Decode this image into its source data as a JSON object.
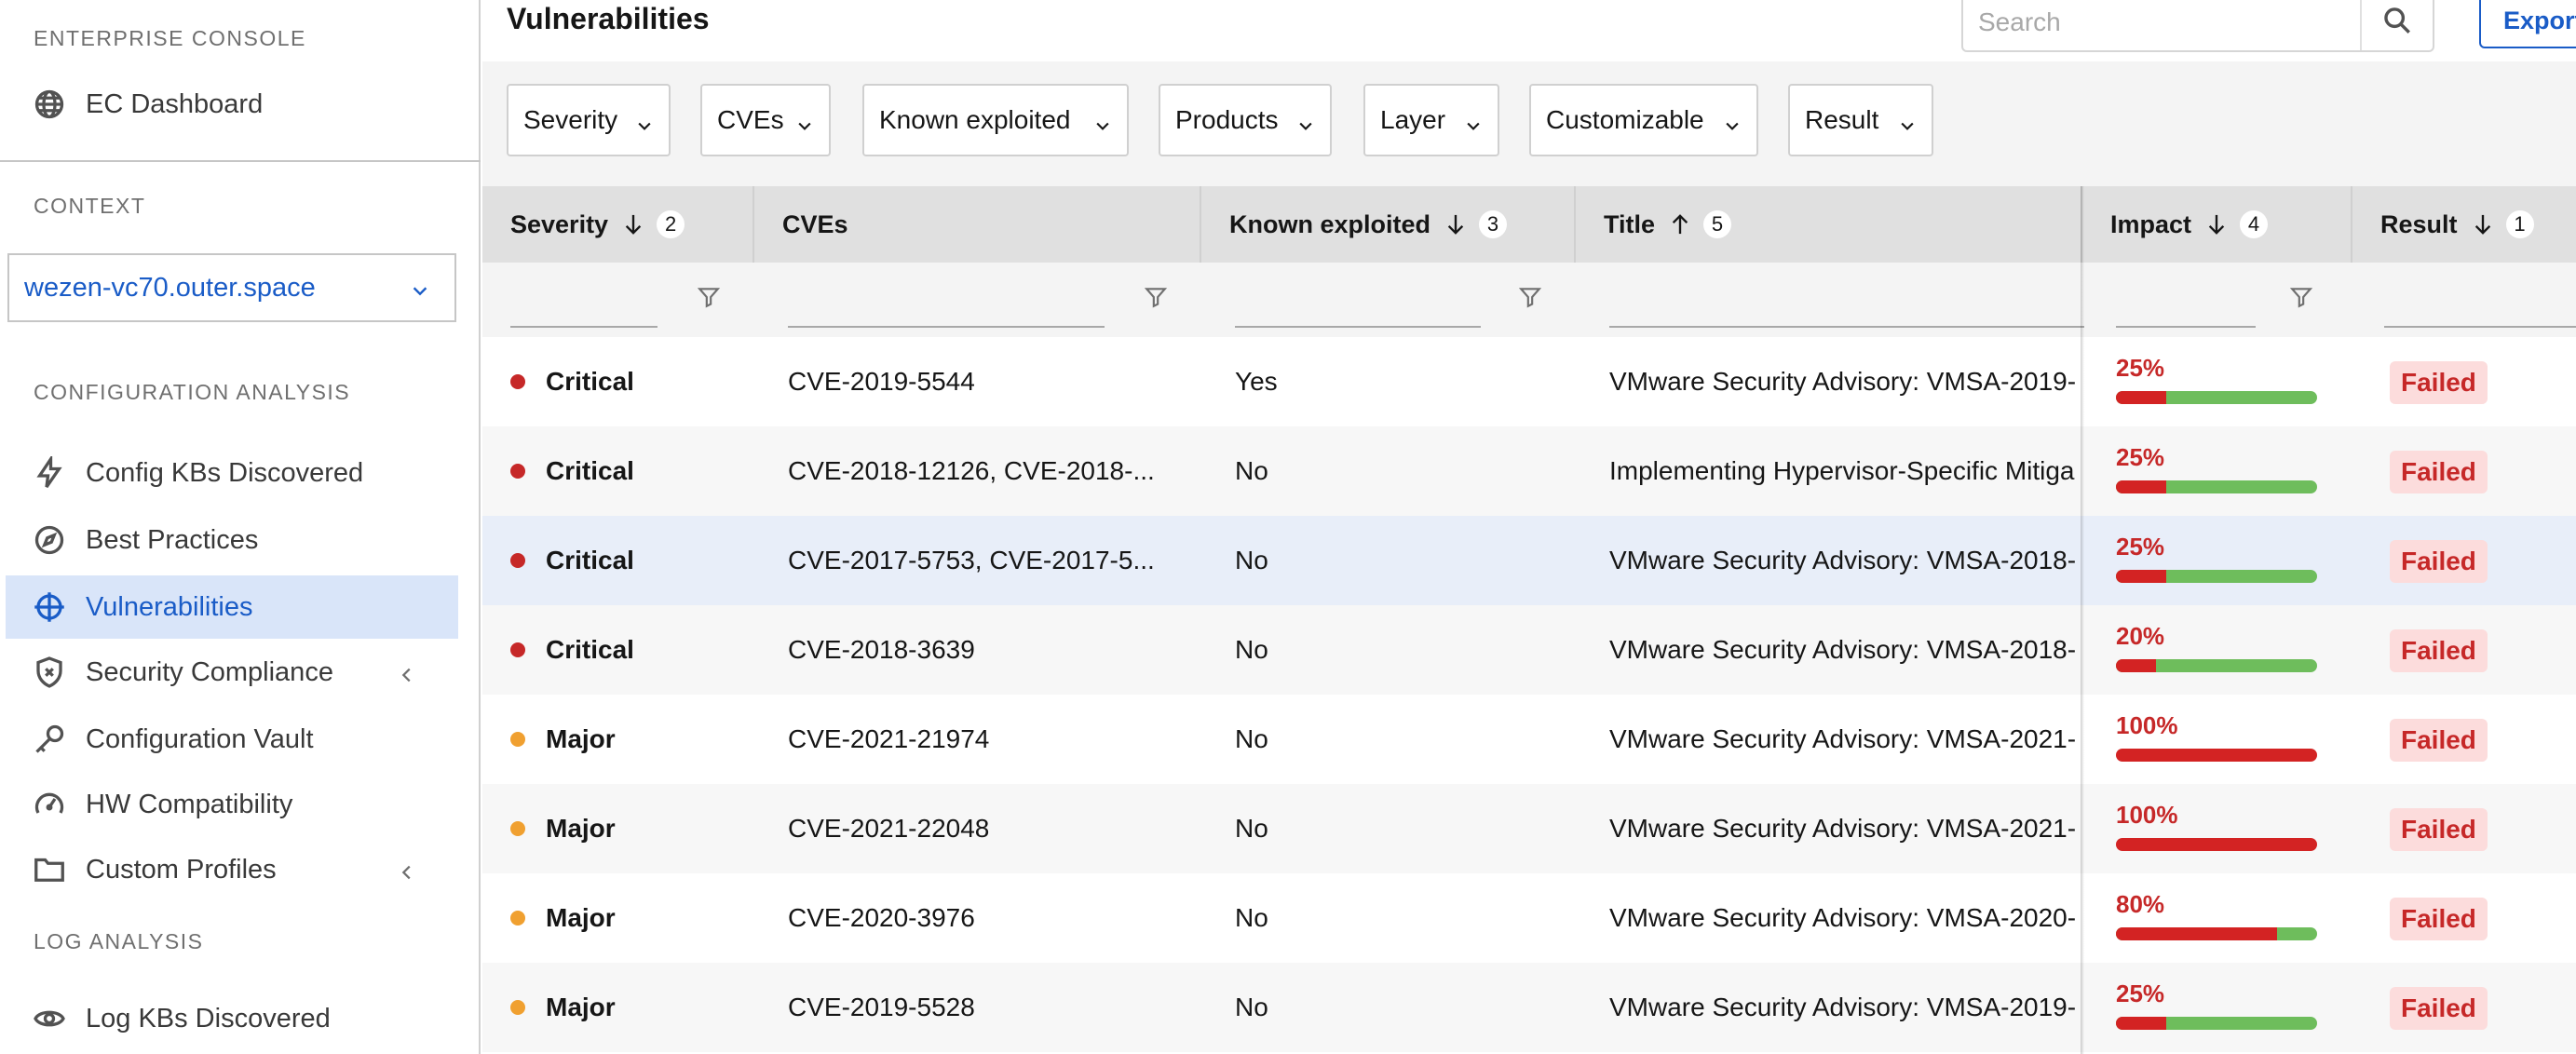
{
  "sidebar": {
    "enterprise_title": "ENTERPRISE CONSOLE",
    "ec_dashboard": "EC Dashboard",
    "context_title": "CONTEXT",
    "context_value": "wezen-vc70.outer.space",
    "config_title": "CONFIGURATION ANALYSIS",
    "items": [
      {
        "label": "Config KBs Discovered",
        "icon": "bolt-icon"
      },
      {
        "label": "Best Practices",
        "icon": "compass-icon"
      },
      {
        "label": "Vulnerabilities",
        "icon": "crosshair-icon",
        "active": true
      },
      {
        "label": "Security Compliance",
        "icon": "shield-icon",
        "expandable": true
      },
      {
        "label": "Configuration Vault",
        "icon": "key-icon"
      },
      {
        "label": "HW Compatibility",
        "icon": "gauge-icon"
      },
      {
        "label": "Custom Profiles",
        "icon": "folder-icon",
        "expandable": true
      }
    ],
    "log_title": "LOG ANALYSIS",
    "log_items": [
      {
        "label": "Log KBs Discovered",
        "icon": "eye-icon"
      }
    ]
  },
  "header": {
    "title": "Vulnerabilities",
    "search_placeholder": "Search",
    "export_label": "Export"
  },
  "filters": [
    "Severity",
    "CVEs",
    "Known exploited",
    "Products",
    "Layer",
    "Customizable",
    "Result"
  ],
  "columns": {
    "severity": {
      "label": "Severity",
      "sort": "desc",
      "rank": "2"
    },
    "cves": {
      "label": "CVEs"
    },
    "known": {
      "label": "Known exploited",
      "sort": "desc",
      "rank": "3"
    },
    "title": {
      "label": "Title",
      "sort": "asc",
      "rank": "5"
    },
    "impact": {
      "label": "Impact",
      "sort": "desc",
      "rank": "4"
    },
    "result": {
      "label": "Result",
      "sort": "desc",
      "rank": "1"
    }
  },
  "colors": {
    "critical": "#c62828",
    "major": "#f0a030",
    "accent": "#1a5cc7"
  },
  "rows": [
    {
      "severity": "Critical",
      "cves": "CVE-2019-5544",
      "known": "Yes",
      "title": "VMware Security Advisory: VMSA-2019-",
      "impact": "25%",
      "impact_value": 0.25,
      "result": "Failed"
    },
    {
      "severity": "Critical",
      "cves": "CVE-2018-12126, CVE-2018-...",
      "known": "No",
      "title": "Implementing Hypervisor-Specific Mitiga",
      "impact": "25%",
      "impact_value": 0.25,
      "result": "Failed"
    },
    {
      "severity": "Critical",
      "cves": "CVE-2017-5753, CVE-2017-5...",
      "known": "No",
      "title": "VMware Security Advisory: VMSA-2018-",
      "impact": "25%",
      "impact_value": 0.25,
      "result": "Failed"
    },
    {
      "severity": "Critical",
      "cves": "CVE-2018-3639",
      "known": "No",
      "title": "VMware Security Advisory: VMSA-2018-",
      "impact": "20%",
      "impact_value": 0.2,
      "result": "Failed"
    },
    {
      "severity": "Major",
      "cves": "CVE-2021-21974",
      "known": "No",
      "title": "VMware Security Advisory: VMSA-2021-",
      "impact": "100%",
      "impact_value": 1.0,
      "result": "Failed"
    },
    {
      "severity": "Major",
      "cves": "CVE-2021-22048",
      "known": "No",
      "title": "VMware Security Advisory: VMSA-2021-",
      "impact": "100%",
      "impact_value": 1.0,
      "result": "Failed"
    },
    {
      "severity": "Major",
      "cves": "CVE-2020-3976",
      "known": "No",
      "title": "VMware Security Advisory: VMSA-2020-",
      "impact": "80%",
      "impact_value": 0.8,
      "result": "Failed"
    },
    {
      "severity": "Major",
      "cves": "CVE-2019-5528",
      "known": "No",
      "title": "VMware Security Advisory: VMSA-2019-",
      "impact": "25%",
      "impact_value": 0.25,
      "result": "Failed"
    }
  ]
}
